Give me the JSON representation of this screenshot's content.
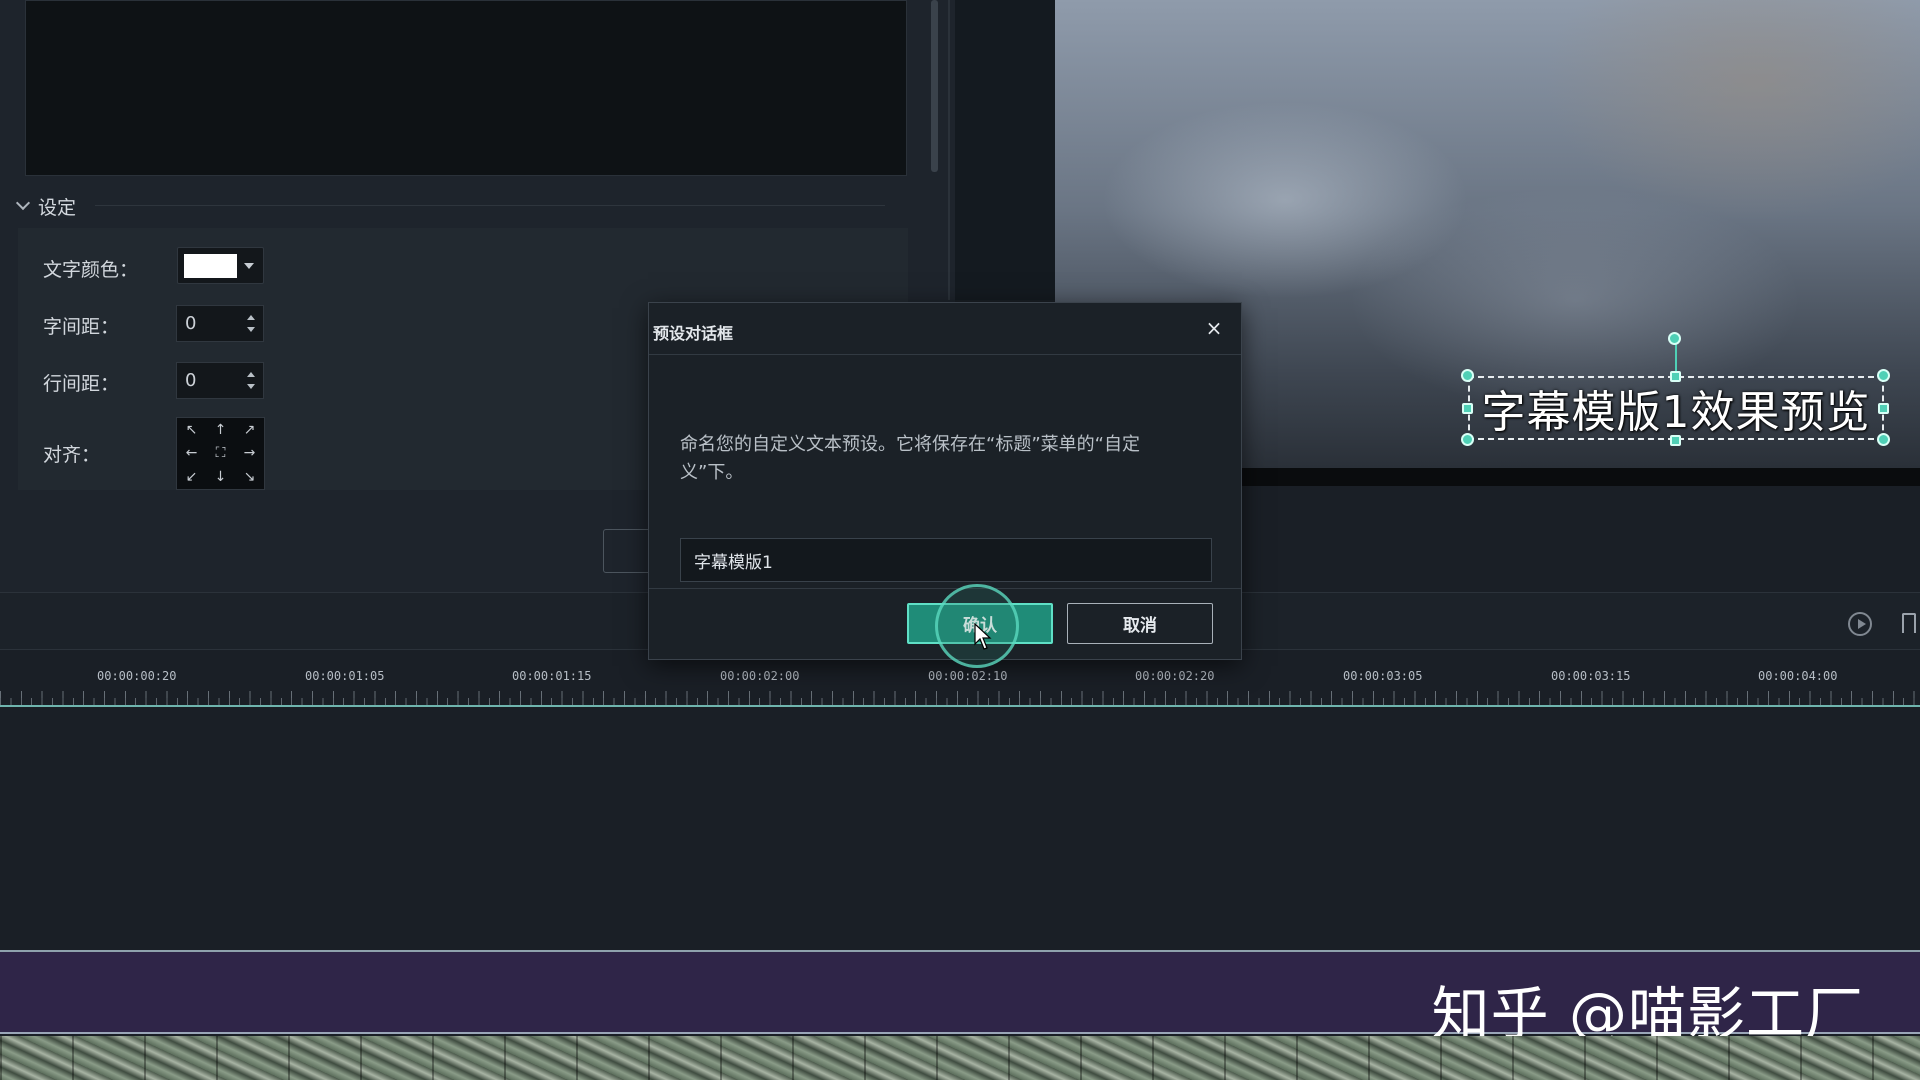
{
  "settings": {
    "header": "设定",
    "text_color_label": "文字颜色：",
    "text_color_value": "#ffffff",
    "letter_spacing_label": "字间距：",
    "letter_spacing_value": "0",
    "line_spacing_label": "行间距：",
    "line_spacing_value": "0",
    "align_label": "对齐："
  },
  "align_icons": [
    "arrow-up-left",
    "arrow-up",
    "arrow-up-right",
    "arrow-left",
    "center",
    "arrow-right",
    "arrow-down-left",
    "arrow-down",
    "arrow-down-right"
  ],
  "preview": {
    "caption": "字幕模版1效果预览"
  },
  "dialog": {
    "title": "预设对话框",
    "close": "×",
    "message": "命名您的自定义文本预设。它将保存在“标题”菜单的“自定义”下。",
    "input_value": "字幕模版1",
    "confirm": "确认",
    "cancel": "取消"
  },
  "timeline": {
    "ticks": [
      "00:00:00:20",
      "00:00:01:05",
      "00:00:01:15",
      "00:00:02:00",
      "00:00:02:10",
      "00:00:02:20",
      "00:00:03:05",
      "00:00:03:15",
      "00:00:04:00"
    ]
  },
  "watermark": "知乎 @喵影工厂",
  "colors": {
    "accent": "#4fd0b6",
    "confirm_bg": "#1f8c78",
    "banner_bg": "#2f2548"
  }
}
